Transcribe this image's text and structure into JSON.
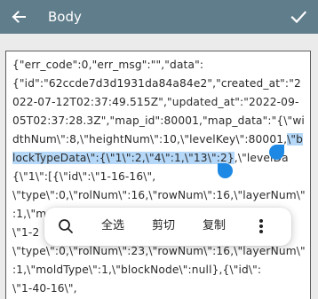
{
  "appbar": {
    "title": "Body",
    "back_icon": "arrow-left-icon",
    "done_icon": "check-icon",
    "background": "#607d8b"
  },
  "editor": {
    "lines": [
      [
        "{\"err_code\":0,\"err_msg\":\"\",\"data\":"
      ],
      [
        "{\"id\":\"62ccde7d3d1931da84a84e2\",\"created_at\":\"2"
      ],
      [
        "022-07-12T02:37:49.515Z\",\"updated_at\":\"2022-09-"
      ],
      [
        "05T02:37:28.3Z\",\"map_id\":80001,\"map_data\":\"{\\\"wi"
      ],
      [
        "dthNum\\\":8,\\\"heightNum\\\":10,\\\"levelKey\\\":80001,",
        "\\\"b"
      ],
      [
        "lockTypeData\\\":{\\\"1\\\":2,\\\"4\\\":1,\\\"13\\\":2}",
        ",\\\"levelDa"
      ],
      [
        "{\\\"1\\\":[{\\\"id\\\":\\\"1-16-16\\\","
      ],
      [
        "\\\"type\\\":0,\\\"rolNum\\\":16,\\\"rowNum\\\":16,\\\"layerNum\\\""
      ],
      [
        ":1,\\\"moldType\\\":1,\\\"blockNode\\\":null},{\\\"id\\\":"
      ],
      [
        "\\\"1-2"
      ],
      [
        "\\\"type\\\":0,\\\"rolNum\\\":23,\\\"rowNum\\\":16,\\\"layerNum\\\""
      ],
      [
        ":1,\\\"moldType\\\":1,\\\"blockNode\\\":null},{\\\"id\\\":"
      ],
      [
        "\\\"1-40-16\\\","
      ]
    ],
    "selection_color": "#b5d8f8",
    "handle_color": "#1e88e5"
  },
  "toolbar": {
    "search_icon": "search-icon",
    "select_all": "全选",
    "cut": "剪切",
    "copy": "复制",
    "more_icon": "more-vert-icon"
  }
}
